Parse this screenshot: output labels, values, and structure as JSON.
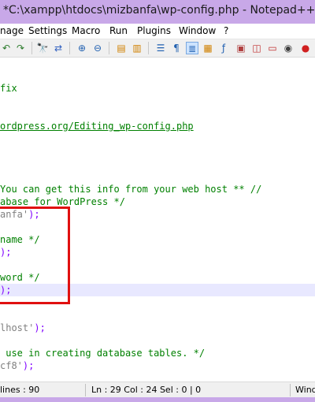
{
  "window": {
    "title": "*C:\\xampp\\htdocs\\mizbanfa\\wp-config.php - Notepad++"
  },
  "menu": [
    "nage",
    "Settings",
    "Macro",
    "Run",
    "Plugins",
    "Window",
    "?"
  ],
  "toolbar_icons": [
    "undo-icon",
    "redo-icon",
    "find-icon",
    "replace-icon",
    "zoom-in-icon",
    "zoom-out-icon",
    "sync-v-icon",
    "sync-h-icon",
    "word-wrap-icon",
    "show-all-chars-icon",
    "indent-guide-icon",
    "doc-map-icon",
    "function-list-icon",
    "folder-workspace-icon",
    "monitor-icon",
    "record-macro-icon"
  ],
  "editor": {
    "lines": [
      {
        "segments": [
          {
            "text": "fix",
            "cls": "c-comment"
          }
        ]
      },
      {
        "segments": [
          {
            "text": "",
            "cls": ""
          }
        ]
      },
      {
        "segments": [
          {
            "text": "",
            "cls": ""
          }
        ]
      },
      {
        "segments": [
          {
            "text": "ordpress.org/Editing_wp-config.php",
            "cls": "c-link"
          }
        ]
      },
      {
        "segments": [
          {
            "text": "",
            "cls": ""
          }
        ]
      },
      {
        "segments": [
          {
            "text": "",
            "cls": ""
          }
        ]
      },
      {
        "segments": [
          {
            "text": "",
            "cls": ""
          }
        ]
      },
      {
        "segments": [
          {
            "text": "",
            "cls": ""
          }
        ]
      },
      {
        "segments": [
          {
            "text": "You can get this info from your web host ** //",
            "cls": "c-comment"
          }
        ]
      },
      {
        "segments": [
          {
            "text": "abase for WordPress */",
            "cls": "c-comment"
          }
        ]
      },
      {
        "segments": [
          {
            "text": "anfa'",
            "cls": "c-str"
          },
          {
            "text": ");",
            "cls": "c-op"
          }
        ]
      },
      {
        "segments": [
          {
            "text": "",
            "cls": ""
          }
        ]
      },
      {
        "segments": [
          {
            "text": "name */",
            "cls": "c-comment"
          }
        ]
      },
      {
        "segments": [
          {
            "text": ");",
            "cls": "c-op"
          }
        ]
      },
      {
        "segments": [
          {
            "text": "",
            "cls": ""
          }
        ]
      },
      {
        "segments": [
          {
            "text": "word */",
            "cls": "c-comment"
          }
        ]
      },
      {
        "segments": [
          {
            "text": ");",
            "cls": "c-op"
          }
        ],
        "current": true
      },
      {
        "segments": [
          {
            "text": "",
            "cls": ""
          }
        ]
      },
      {
        "segments": [
          {
            "text": "",
            "cls": ""
          }
        ]
      },
      {
        "segments": [
          {
            "text": "lhost'",
            "cls": "c-str"
          },
          {
            "text": ");",
            "cls": "c-op"
          }
        ]
      },
      {
        "segments": [
          {
            "text": "",
            "cls": ""
          }
        ]
      },
      {
        "segments": [
          {
            "text": " use in creating database tables. */",
            "cls": "c-comment"
          }
        ]
      },
      {
        "segments": [
          {
            "text": "cf8'",
            "cls": "c-str"
          },
          {
            "text": ");",
            "cls": "c-op"
          }
        ]
      }
    ]
  },
  "status": {
    "lines": "lines : 90",
    "position": "Ln : 29   Col : 24   Sel : 0 | 0",
    "eol": "Wind"
  },
  "colors": {
    "titlebar": "#c8a8e8",
    "comment": "#008000",
    "string": "#808080",
    "operator": "#8000ff",
    "highlight_box": "#e01010",
    "current_line": "#e8e8ff"
  }
}
